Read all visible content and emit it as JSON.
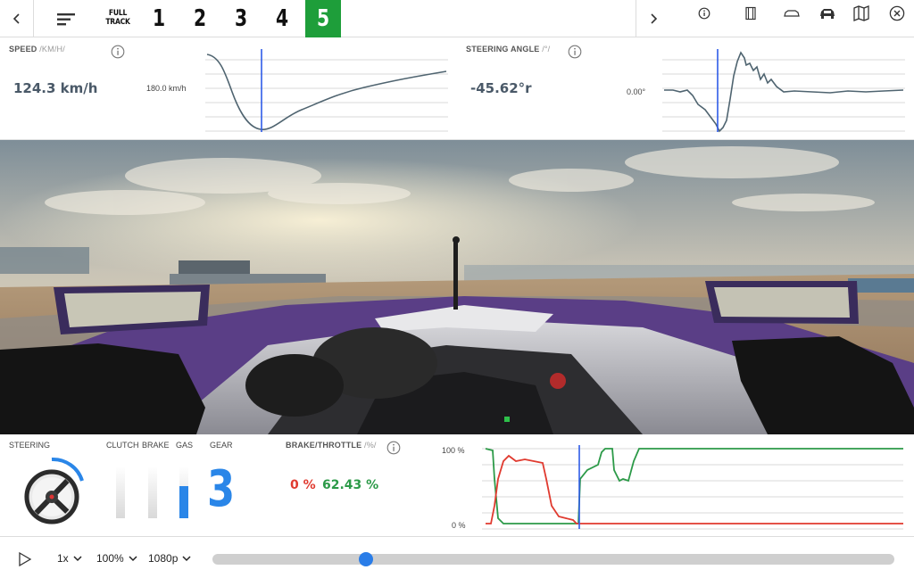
{
  "nav": {
    "full_track_line1": "FULL",
    "full_track_line2": "TRACK",
    "laps": [
      "1",
      "2",
      "3",
      "4",
      "5"
    ],
    "active_lap": "5"
  },
  "speed": {
    "label": "SPEED",
    "unit": "/KM/H/",
    "value": "124.3 km/h",
    "reference": "180.0 km/h"
  },
  "steering_angle": {
    "label": "STEERING ANGLE",
    "unit": "/°/",
    "value": "-45.62°r",
    "reference": "0.00°"
  },
  "controls": {
    "steering_label": "STEERING",
    "clutch_label": "CLUTCH",
    "brake_label": "BRAKE",
    "gas_label": "GAS",
    "gear_label": "GEAR",
    "gear_value": "3",
    "clutch_level": 0,
    "brake_level": 0,
    "gas_level": 0.6243
  },
  "brake_throttle": {
    "label": "BRAKE/THROTTLE",
    "unit": "/%/",
    "brake_value": "0 %",
    "throttle_value": "62.43 %",
    "y_top_label": "100 %",
    "y_bottom_label": "0 %"
  },
  "player": {
    "speed_option": "1x",
    "zoom_option": "100%",
    "quality_option": "1080p",
    "progress": 0.225
  },
  "colors": {
    "accent": "#2a86e8",
    "active_lap": "#1e9e3a",
    "brake": "#e03a2f",
    "throttle": "#2c9a48",
    "trace": "#4f6470"
  }
}
